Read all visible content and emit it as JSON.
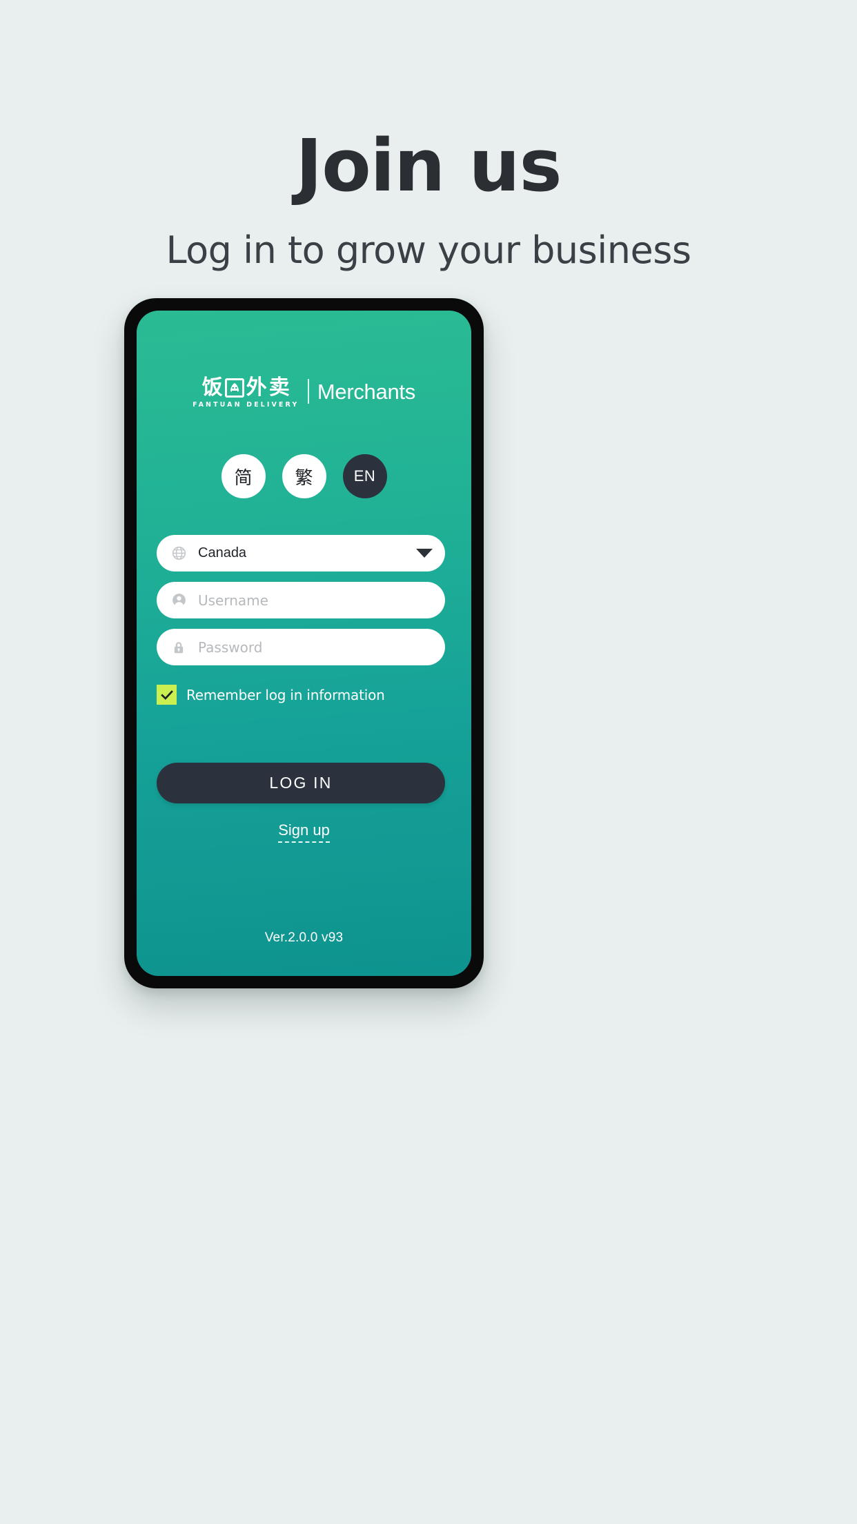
{
  "page": {
    "background_color": "#E8EFEE",
    "headline": "Join us",
    "subheadline": "Log in to grow your business"
  },
  "device": {
    "bezel_color": "#0A0A0A",
    "screen_gradient_top": "#2BBB93",
    "screen_gradient_bottom": "#0E938F"
  },
  "app": {
    "brand": {
      "cn_char_1": "饭",
      "cn_char_2": "外",
      "cn_char_3": "卖",
      "panda_icon": "panda-rice-ball-icon",
      "tagline": "FANTUAN DELIVERY",
      "product_label": "Merchants"
    },
    "language_selector": {
      "options": [
        {
          "label": "简",
          "code": "zh-Hans",
          "selected": false
        },
        {
          "label": "繁",
          "code": "zh-Hant",
          "selected": false
        },
        {
          "label": "EN",
          "code": "en",
          "selected": true
        }
      ],
      "active_bg": "#2B313D",
      "inactive_bg": "#FFFFFF"
    },
    "form": {
      "country": {
        "icon": "globe-icon",
        "value": "Canada",
        "dropdown_icon": "chevron-down-icon"
      },
      "username": {
        "icon": "person-icon",
        "value": "",
        "placeholder": "Username"
      },
      "password": {
        "icon": "lock-icon",
        "value": "",
        "placeholder": "Password"
      },
      "remember": {
        "label": "Remember log in information",
        "checked": true,
        "check_color": "#C9EF50"
      }
    },
    "actions": {
      "login_label": "LOG IN",
      "login_bg": "#2B313D",
      "signup_label": "Sign up"
    },
    "footer": {
      "version": "Ver.2.0.0 v93"
    }
  }
}
